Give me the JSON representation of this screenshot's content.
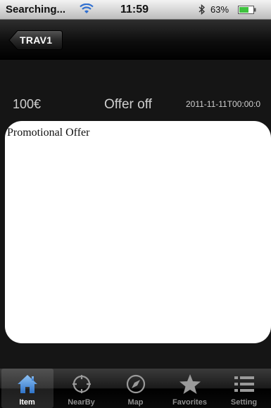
{
  "status_bar": {
    "carrier": "Searching...",
    "time": "11:59",
    "battery": "63%"
  },
  "nav": {
    "back_label": "TRAV1"
  },
  "item": {
    "price": "100€",
    "offer_status": "Offer off",
    "date": "2011-11-11T00:00:0",
    "offer_text": "Promotional Offer"
  },
  "tabs": [
    {
      "label": "Item",
      "icon": "home-icon",
      "active": true
    },
    {
      "label": "NearBy",
      "icon": "crosshair-icon",
      "active": false
    },
    {
      "label": "Map",
      "icon": "compass-icon",
      "active": false
    },
    {
      "label": "Favorites",
      "icon": "star-icon",
      "active": false
    },
    {
      "label": "Setting",
      "icon": "list-icon",
      "active": false
    }
  ],
  "colors": {
    "active_tab_icon": "#4a90d9",
    "battery_fill": "#3ec23e"
  }
}
